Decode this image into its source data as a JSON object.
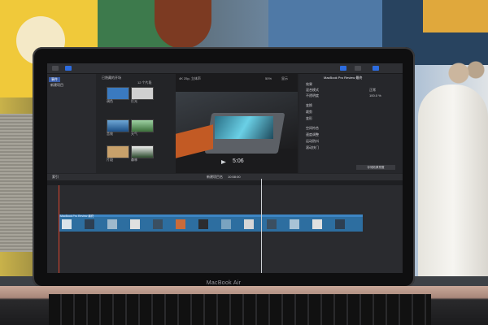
{
  "laptop": {
    "brand": "MacBook Air"
  },
  "app": {
    "topbar": {
      "title": "Final Cut Pro"
    },
    "browser": {
      "items": [
        {
          "label": "事件",
          "selected": true
        },
        {
          "label": "新建项目",
          "selected": false
        }
      ]
    },
    "clips": {
      "header": "已隐藏的开场",
      "count": "12 个片段",
      "items": [
        {
          "label": "调色",
          "color": "#3a7ac0"
        },
        {
          "label": "灯光",
          "color": "#d0d0d0"
        },
        {
          "label": "音效",
          "color": "#6ea7d6"
        },
        {
          "label": "天气",
          "color": "#3b6f3a"
        },
        {
          "label": "片段",
          "color": "#c8a16b"
        },
        {
          "label": "森林",
          "color": "#2c4a2d"
        }
      ]
    },
    "viewer": {
      "format": "4K 25p, 立体声",
      "zoom": "50%",
      "view": "显示",
      "timecode": "5:06"
    },
    "inspector": {
      "title": "MacBook Pro Review 最终",
      "rows": [
        {
          "label": "效果",
          "value": "正常"
        },
        {
          "label": "混合模式",
          "value": "正常"
        },
        {
          "label": "不透明度",
          "value": "100.0 %"
        },
        {
          "label": "变换",
          "value": ""
        },
        {
          "label": "裁剪",
          "value": ""
        },
        {
          "label": "变形",
          "value": ""
        },
        {
          "label": "空间符合",
          "value": ""
        },
        {
          "label": "速度调整",
          "value": ""
        },
        {
          "label": "运动防抖",
          "value": ""
        },
        {
          "label": "滚动快门",
          "value": ""
        }
      ],
      "save_button": "存储效果预置"
    },
    "timeline": {
      "index_label": "索引",
      "project_label": "新建项目名",
      "duration": "10:58:00",
      "clip_label": "MacBook Pro Review 最终"
    }
  }
}
